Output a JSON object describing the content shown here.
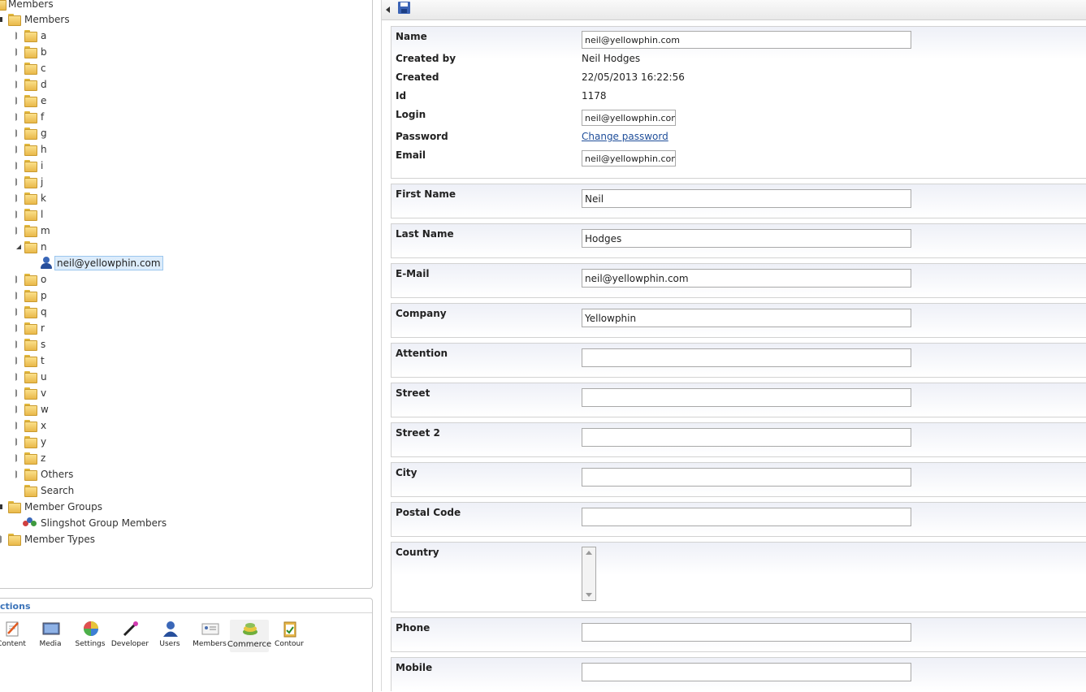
{
  "tree": {
    "root_label": "Members",
    "members_label": "Members",
    "letters": [
      "a",
      "b",
      "c",
      "d",
      "e",
      "f",
      "g",
      "h",
      "i",
      "j",
      "k",
      "l",
      "m",
      "n",
      "o",
      "p",
      "q",
      "r",
      "s",
      "t",
      "u",
      "v",
      "w",
      "x",
      "y",
      "z"
    ],
    "selected_member": "neil@yellowphin.com",
    "others_label": "Others",
    "search_label": "Search",
    "member_groups_label": "Member Groups",
    "slingshot_label": "Slingshot Group Members",
    "member_types_label": "Member Types"
  },
  "sections": {
    "title": "ctions",
    "items": [
      {
        "label": "Content",
        "icon": "content-icon"
      },
      {
        "label": "Media",
        "icon": "media-icon"
      },
      {
        "label": "Settings",
        "icon": "settings-icon"
      },
      {
        "label": "Developer",
        "icon": "developer-icon"
      },
      {
        "label": "Users",
        "icon": "users-icon"
      },
      {
        "label": "Members",
        "icon": "members-icon"
      },
      {
        "label": "Commerce",
        "icon": "commerce-icon"
      },
      {
        "label": "Contour",
        "icon": "contour-icon"
      }
    ]
  },
  "toolbar": {
    "collapse_icon": "collapse-arrow-icon",
    "save_icon": "save-icon"
  },
  "properties": {
    "name_label": "Name",
    "name_value": "neil@yellowphin.com",
    "created_by_label": "Created by",
    "created_by_value": "Neil Hodges",
    "created_label": "Created",
    "created_value": "22/05/2013 16:22:56",
    "id_label": "Id",
    "id_value": "1178",
    "login_label": "Login",
    "login_value": "neil@yellowphin.com",
    "password_label": "Password",
    "password_link": "Change password",
    "email_label": "Email",
    "email_value": "neil@yellowphin.com"
  },
  "fields": {
    "first_name": {
      "label": "First Name",
      "value": "Neil"
    },
    "last_name": {
      "label": "Last Name",
      "value": "Hodges"
    },
    "email": {
      "label": "E-Mail",
      "value": "neil@yellowphin.com"
    },
    "company": {
      "label": "Company",
      "value": "Yellowphin"
    },
    "attention": {
      "label": "Attention",
      "value": ""
    },
    "street": {
      "label": "Street",
      "value": ""
    },
    "street2": {
      "label": "Street 2",
      "value": ""
    },
    "city": {
      "label": "City",
      "value": ""
    },
    "postal_code": {
      "label": "Postal Code",
      "value": ""
    },
    "country": {
      "label": "Country",
      "value": ""
    },
    "phone": {
      "label": "Phone",
      "value": ""
    },
    "mobile": {
      "label": "Mobile",
      "value": ""
    }
  }
}
